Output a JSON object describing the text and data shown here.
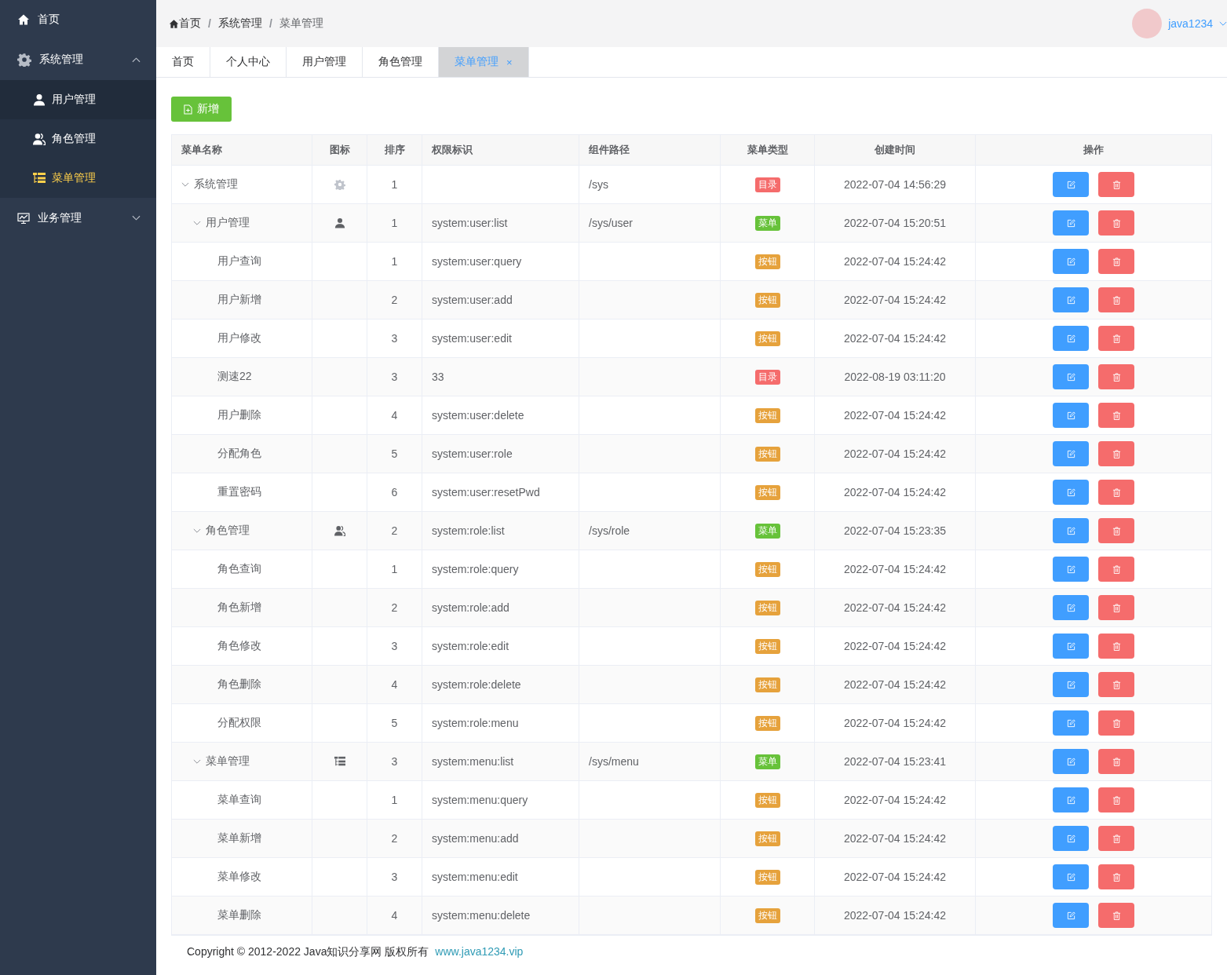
{
  "sidebar": {
    "items": [
      {
        "label": "首页",
        "selected": false
      },
      {
        "label": "系统管理",
        "selected": false,
        "expanded": true,
        "children": [
          {
            "label": "用户管理",
            "selected": false
          },
          {
            "label": "角色管理",
            "selected": false
          },
          {
            "label": "菜单管理",
            "selected": true
          }
        ]
      },
      {
        "label": "业务管理",
        "selected": false,
        "expanded": false
      }
    ]
  },
  "breadcrumb": {
    "separator": "/",
    "items": [
      "首页",
      "系统管理",
      "菜单管理"
    ]
  },
  "user": {
    "name": "java1234"
  },
  "tabs": [
    {
      "label": "首页",
      "selected": false
    },
    {
      "label": "个人中心",
      "selected": false
    },
    {
      "label": "用户管理",
      "selected": false
    },
    {
      "label": "角色管理",
      "selected": false
    },
    {
      "label": "菜单管理",
      "selected": true,
      "close": "×"
    }
  ],
  "add_button": "新增",
  "table": {
    "columns": [
      "菜单名称",
      "图标",
      "排序",
      "权限标识",
      "组件路径",
      "菜单类型",
      "创建时间",
      "操作"
    ],
    "rows": [
      {
        "name": "系统管理",
        "order": "1",
        "perms": "",
        "path": "/sys",
        "kind": "directory",
        "type_label": "目录",
        "created": "2022-07-04 14:56:29",
        "expanded": true,
        "children": [
          {
            "name": "用户管理",
            "order": "1",
            "perms": "system:user:list",
            "path": "/sys/user",
            "kind": "menu",
            "type_label": "菜单",
            "created": "2022-07-04 15:20:51",
            "expanded": true,
            "children": [
              {
                "name": "用户查询",
                "order": "1",
                "perms": "system:user:query",
                "kind": "button",
                "type_label": "按钮",
                "created": "2022-07-04 15:24:42"
              },
              {
                "name": "用户新增",
                "order": "2",
                "perms": "system:user:add",
                "kind": "button",
                "type_label": "按钮",
                "created": "2022-07-04 15:24:42"
              },
              {
                "name": "用户修改",
                "order": "3",
                "perms": "system:user:edit",
                "kind": "button",
                "type_label": "按钮",
                "created": "2022-07-04 15:24:42"
              },
              {
                "name": "测速22",
                "order": "3",
                "perms": "33",
                "kind": "directory",
                "type_label": "目录",
                "created": "2022-08-19 03:11:20"
              },
              {
                "name": "用户删除",
                "order": "4",
                "perms": "system:user:delete",
                "kind": "button",
                "type_label": "按钮",
                "created": "2022-07-04 15:24:42"
              },
              {
                "name": "分配角色",
                "order": "5",
                "perms": "system:user:role",
                "kind": "button",
                "type_label": "按钮",
                "created": "2022-07-04 15:24:42"
              },
              {
                "name": "重置密码",
                "order": "6",
                "perms": "system:user:resetPwd",
                "kind": "button",
                "type_label": "按钮",
                "created": "2022-07-04 15:24:42"
              }
            ]
          },
          {
            "name": "角色管理",
            "order": "2",
            "perms": "system:role:list",
            "path": "/sys/role",
            "kind": "menu",
            "type_label": "菜单",
            "created": "2022-07-04 15:23:35",
            "expanded": true,
            "children": [
              {
                "name": "角色查询",
                "order": "1",
                "perms": "system:role:query",
                "kind": "button",
                "type_label": "按钮",
                "created": "2022-07-04 15:24:42"
              },
              {
                "name": "角色新增",
                "order": "2",
                "perms": "system:role:add",
                "kind": "button",
                "type_label": "按钮",
                "created": "2022-07-04 15:24:42"
              },
              {
                "name": "角色修改",
                "order": "3",
                "perms": "system:role:edit",
                "kind": "button",
                "type_label": "按钮",
                "created": "2022-07-04 15:24:42"
              },
              {
                "name": "角色删除",
                "order": "4",
                "perms": "system:role:delete",
                "kind": "button",
                "type_label": "按钮",
                "created": "2022-07-04 15:24:42"
              },
              {
                "name": "分配权限",
                "order": "5",
                "perms": "system:role:menu",
                "kind": "button",
                "type_label": "按钮",
                "created": "2022-07-04 15:24:42"
              }
            ]
          },
          {
            "name": "菜单管理",
            "order": "3",
            "perms": "system:menu:list",
            "path": "/sys/menu",
            "kind": "menu",
            "type_label": "菜单",
            "created": "2022-07-04 15:23:41",
            "expanded": true,
            "children": [
              {
                "name": "菜单查询",
                "order": "1",
                "perms": "system:menu:query",
                "kind": "button",
                "type_label": "按钮",
                "created": "2022-07-04 15:24:42"
              },
              {
                "name": "菜单新增",
                "order": "2",
                "perms": "system:menu:add",
                "kind": "button",
                "type_label": "按钮",
                "created": "2022-07-04 15:24:42"
              },
              {
                "name": "菜单修改",
                "order": "3",
                "perms": "system:menu:edit",
                "kind": "button",
                "type_label": "按钮",
                "created": "2022-07-04 15:24:42"
              },
              {
                "name": "菜单删除",
                "order": "4",
                "perms": "system:menu:delete",
                "kind": "button",
                "type_label": "按钮",
                "created": "2022-07-04 15:24:42"
              }
            ]
          }
        ]
      }
    ]
  },
  "footer": {
    "text": "Copyright © 2012-2022 Java知识分享网 版权所有",
    "link": "www.java1234.vip"
  }
}
